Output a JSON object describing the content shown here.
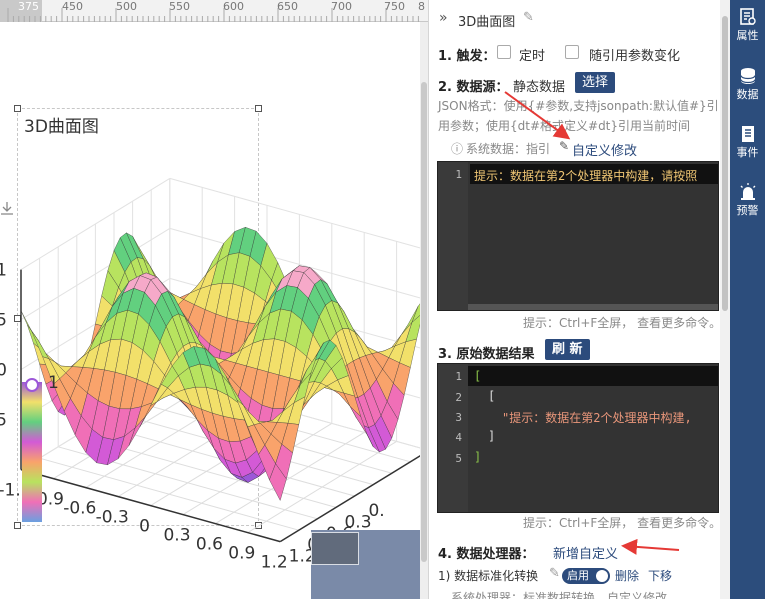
{
  "ruler": {
    "ticks": [
      "375",
      "450",
      "500",
      "550",
      "600",
      "650",
      "700",
      "750",
      "8"
    ]
  },
  "chart": {
    "title": "3D曲面图"
  },
  "chart_data": {
    "type": "surface",
    "title": "3D曲面图",
    "z_ticks": [
      "1",
      "0.5",
      "0",
      "-0.5"
    ],
    "x_ticks": [
      "-1.2",
      "-0.9",
      "-0.6",
      "-0.3",
      "0",
      "0.3",
      "0.6",
      "0.9",
      "1.2"
    ],
    "y_ticks": [
      "1.2",
      "0.9",
      "0.6",
      "0.3",
      "0."
    ],
    "zlim": [
      -1,
      1
    ],
    "visualmap": {
      "max_label": "1"
    }
  },
  "panel": {
    "header": {
      "expand_icon": "double-chevron-right-icon",
      "title": "3D曲面图"
    },
    "trigger": {
      "label": "1. 触发：",
      "timer": "定时",
      "follow_param": "随引用参数变化"
    },
    "datasource": {
      "label": "2. 数据源：",
      "value": "静态数据",
      "select_btn": "选择",
      "hint_line1": "JSON格式：使用{#参数,支持jsonpath:默认值#}引",
      "hint_line2": "用参数；使用{dt#格式定义#dt}引用当前时间",
      "sys_data": "系统数据：指引",
      "custom_edit": "自定义修改",
      "code_line1": "提示：数据在第2个处理器中构建，请按照",
      "editor_hint": "提示：Ctrl+F全屏， 查看更多命令。"
    },
    "rawresult": {
      "label": "3. 原始数据结果",
      "refresh_btn": "刷 新",
      "lines": [
        "[",
        "[",
        "\"提示：数据在第2个处理器中构建,",
        "]",
        "]"
      ],
      "line_numbers": [
        "1",
        "2",
        "3",
        "4",
        "5"
      ],
      "editor_hint": "提示：Ctrl+F全屏， 查看更多命令。"
    },
    "processor": {
      "label": "4. 数据处理器：",
      "add_custom": "新增自定义",
      "item1_name": "1) 数据标准化转换",
      "item1_toggle": "启用",
      "item1_delete": "删除",
      "item1_down": "下移",
      "item1_sub": "系统处理器：标准数据转换，自定义修改"
    }
  },
  "toolbar": {
    "props": "属性",
    "data": "数据",
    "event": "事件",
    "alarm": "预警"
  },
  "colors": {
    "accent": "#2c4b7c",
    "toolbar_bg": "#2c4d7c",
    "editor_bg": "#333333",
    "annotation_arrow": "#e53935"
  }
}
